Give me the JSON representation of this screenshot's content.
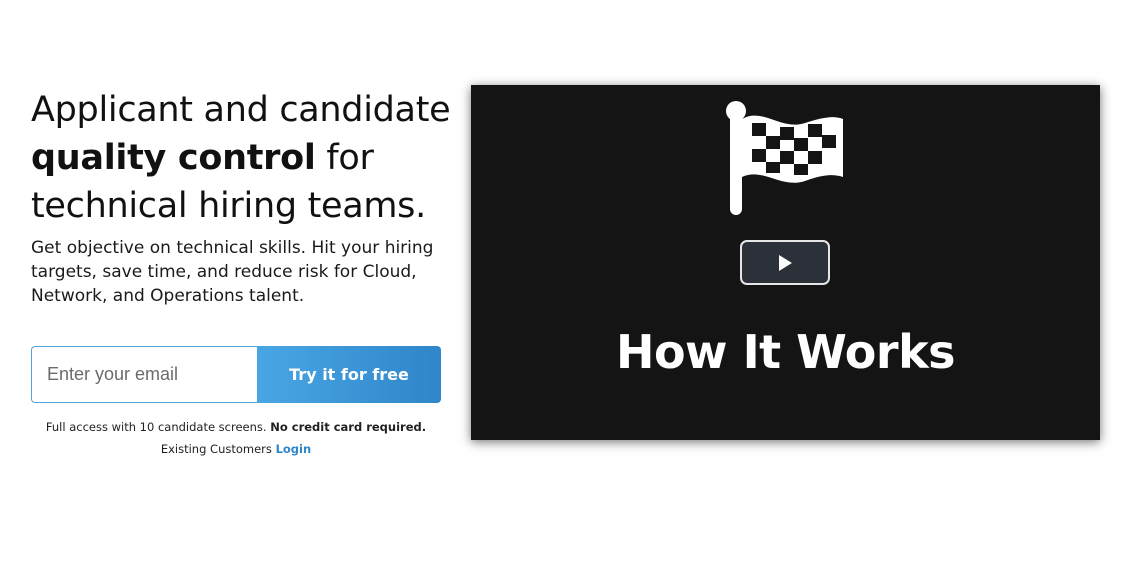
{
  "hero": {
    "headline_part1": "Applicant and candidate",
    "headline_strong": "quality control",
    "headline_part2": " for",
    "headline_part3": "technical hiring teams.",
    "subhead": "Get objective on technical skills. Hit your hiring targets, save time, and reduce risk for Cloud, Network, and Operations talent."
  },
  "signup": {
    "email_placeholder": "Enter your email",
    "email_value": "",
    "button_label": "Try it for free",
    "fineprint_text": "Full access with 10 candidate screens.",
    "fineprint_bold": "No credit card required.",
    "existing_text": "Existing Customers",
    "login_label": "Login"
  },
  "video": {
    "title": "How It Works",
    "icon": "checkered-flag-icon",
    "play_icon": "play-icon"
  },
  "colors": {
    "accent": "#2f86c9",
    "button_gradient_start": "#49a6e4",
    "video_background": "#141414"
  }
}
